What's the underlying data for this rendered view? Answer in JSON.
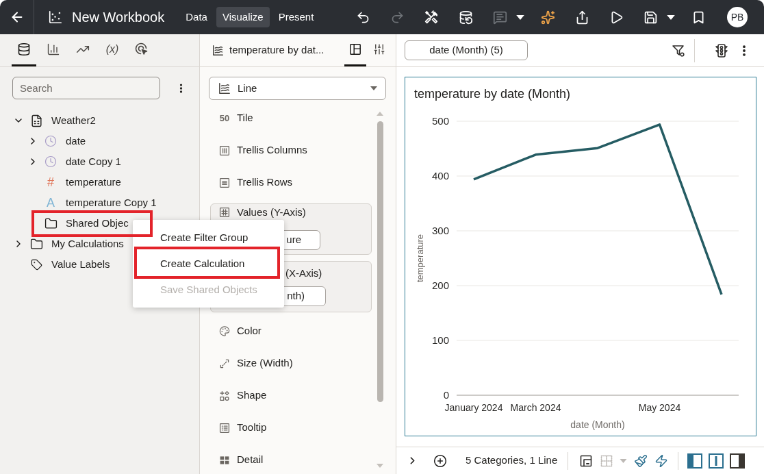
{
  "top_bar": {
    "title": "New Workbook",
    "modes": [
      {
        "label": "Data",
        "selected": false
      },
      {
        "label": "Visualize",
        "selected": true
      },
      {
        "label": "Present",
        "selected": false
      }
    ],
    "tools": [
      {
        "kind": "undo",
        "disabled": false,
        "has_menu": false
      },
      {
        "kind": "redo",
        "disabled": true,
        "has_menu": false
      },
      {
        "kind": "tools",
        "disabled": false,
        "has_menu": false
      },
      {
        "kind": "data",
        "disabled": false,
        "has_menu": false
      },
      {
        "kind": "comments",
        "disabled": true,
        "has_menu": true
      },
      {
        "kind": "sparkle",
        "disabled": false,
        "has_menu": false
      },
      {
        "kind": "export",
        "disabled": false,
        "has_menu": false
      },
      {
        "kind": "play",
        "disabled": false,
        "has_menu": false
      },
      {
        "kind": "save",
        "disabled": false,
        "has_menu": true
      },
      {
        "kind": "bookmark",
        "disabled": false,
        "has_menu": false
      }
    ],
    "avatar": "PB"
  },
  "data_panel": {
    "tabs": [
      {
        "kind": "data",
        "selected": true
      },
      {
        "kind": "visualizations",
        "selected": false
      },
      {
        "kind": "analytics",
        "selected": false
      },
      {
        "kind": "calculations",
        "label": "(x)",
        "selected": false
      },
      {
        "kind": "actions",
        "selected": false
      }
    ],
    "search": {
      "placeholder": "Search"
    },
    "tree": [
      {
        "label": "Weather2",
        "kind": "dataset",
        "expanded": true,
        "highlighted": false,
        "children": [
          {
            "label": "date",
            "kind": "time",
            "expanded": false,
            "highlighted": false
          },
          {
            "label": "date Copy 1",
            "kind": "time",
            "expanded": false,
            "highlighted": false
          },
          {
            "label": "temperature",
            "kind": "measure",
            "glyph": "#",
            "highlighted": false
          },
          {
            "label": "temperature Copy 1",
            "kind": "attribute",
            "glyph": "A",
            "highlighted": false
          },
          {
            "label": "Shared Objec",
            "kind": "folder",
            "highlighted": true
          }
        ]
      },
      {
        "label": "My Calculations",
        "kind": "folder",
        "expanded": false,
        "highlighted": false
      },
      {
        "label": "Value Labels",
        "kind": "tag",
        "highlighted": false
      }
    ]
  },
  "context_menu": {
    "items": [
      {
        "label": "Create Filter Group",
        "disabled": false,
        "highlighted": false
      },
      {
        "label": "Create Calculation",
        "disabled": false,
        "highlighted": true
      },
      {
        "label": "Save Shared Objects",
        "disabled": true,
        "highlighted": false
      }
    ]
  },
  "grammar_panel": {
    "title": "temperature by dat...",
    "tabs": [
      {
        "kind": "layout",
        "selected": true
      },
      {
        "kind": "properties",
        "selected": false
      }
    ],
    "chart_type": "Line",
    "drop_targets": [
      {
        "kind": "tile",
        "glyph": "50",
        "label": "Tile"
      },
      {
        "kind": "columns",
        "label": "Trellis Columns"
      },
      {
        "kind": "rows",
        "label": "Trellis Rows"
      },
      {
        "kind": "values",
        "label": "Values (Y-Axis)",
        "field": "ure"
      },
      {
        "kind": "category",
        "label": "(X-Axis)",
        "field": "nth)"
      },
      {
        "kind": "color",
        "label": "Color"
      },
      {
        "kind": "size",
        "label": "Size (Width)"
      },
      {
        "kind": "shape",
        "label": "Shape"
      },
      {
        "kind": "tooltip",
        "label": "Tooltip"
      },
      {
        "kind": "detail",
        "label": "Detail"
      }
    ]
  },
  "canvas": {
    "filters": [
      "date (Month) (5)"
    ],
    "chart": {
      "chart_data": {
        "type": "line",
        "title": "temperature by date (Month)",
        "xlabel": "date (Month)",
        "ylabel": "temperature",
        "categories": [
          "January 2024",
          "March 2024",
          null,
          "May 2024",
          null
        ],
        "series": [
          {
            "color": "#255c63",
            "values": [
              394,
              439,
              451,
              494,
              184
            ]
          }
        ],
        "ylim": [
          0,
          500
        ],
        "yticks": [
          0,
          100,
          200,
          300,
          400,
          500
        ],
        "grid": true
      }
    },
    "status_bar": {
      "summary": "5 Categories, 1 Line",
      "tools": [
        {
          "kind": "canvas",
          "disabled": false,
          "has_menu": false
        },
        {
          "kind": "grid",
          "disabled": true,
          "has_menu": true
        },
        {
          "kind": "brush",
          "disabled": false,
          "has_menu": false
        },
        {
          "kind": "lightning",
          "disabled": false,
          "has_menu": false
        }
      ],
      "layouts": [
        {
          "kind": "left"
        },
        {
          "kind": "center"
        },
        {
          "kind": "right"
        }
      ]
    }
  }
}
